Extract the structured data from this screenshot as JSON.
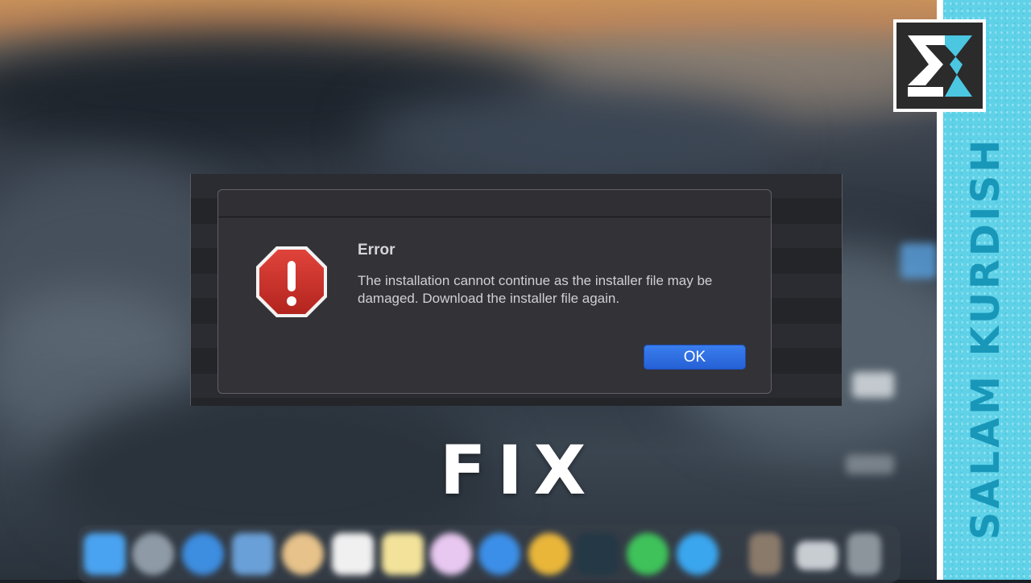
{
  "dialog": {
    "title": "Error",
    "message": "The installation cannot continue as the installer file may be damaged. Download the installer file again.",
    "ok_label": "OK",
    "icon": "error-stop-icon"
  },
  "overlay": {
    "fix_text": "FIX",
    "channel_name": "SALAM KURDISH",
    "logo": "channel-logo-sk"
  },
  "colors": {
    "accent_button": "#2a6ae0",
    "error_icon": "#c8312c",
    "banner": "#5fd2e8",
    "banner_text": "#1897b9"
  },
  "dock": {
    "icons": [
      "finder-icon",
      "launchpad-icon",
      "safari-icon",
      "preview-icon",
      "photos-icon",
      "calendar-icon",
      "notes-icon",
      "itunes-icon",
      "app-store-icon",
      "chrome-icon",
      "photoshop-icon",
      "whatsapp-icon",
      "twitter-icon",
      "downloads-icon",
      "finder-window-icon",
      "trash-icon"
    ]
  }
}
